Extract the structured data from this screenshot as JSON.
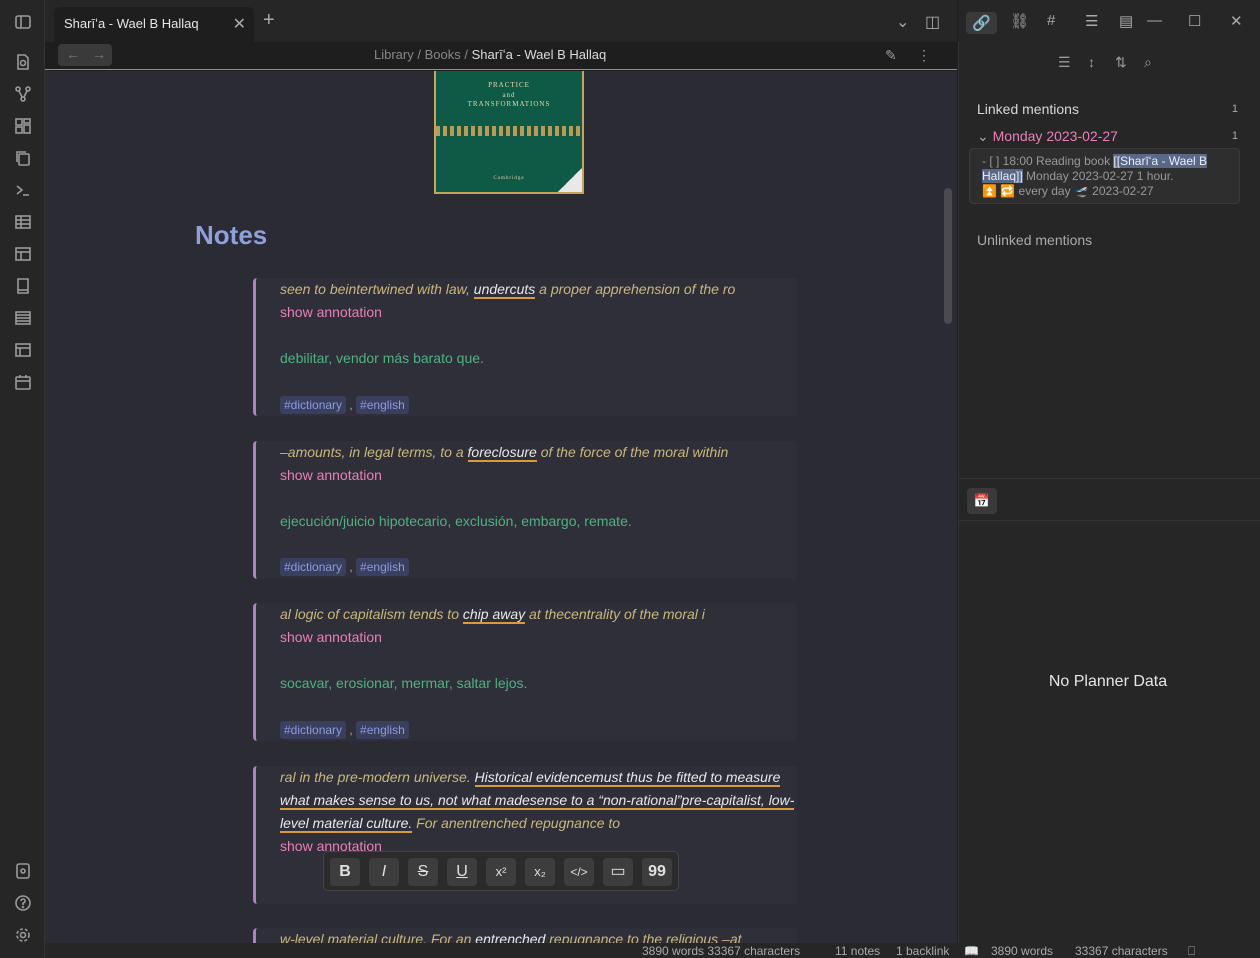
{
  "tab": {
    "title": "Sharīʻa - Wael B Hallaq"
  },
  "breadcrumb": {
    "library": "Library",
    "sep1": "/",
    "books": "Books",
    "sep2": "/",
    "current": "Sharīʻa - Wael B Hallaq"
  },
  "cover": {
    "line1": "PRACTICE",
    "line2": "and",
    "line3": "TRANSFORMATIONS",
    "publisher": "Cambridge"
  },
  "notes_heading": "Notes",
  "callouts": [
    {
      "pre": "seen to beintertwined with law, ",
      "hl": "undercuts",
      "post": " a proper apprehension of the ro",
      "show": "show annotation",
      "translation": "debilitar, vendor más barato que.",
      "tag1": "#dictionary",
      "tag2": "#english"
    },
    {
      "pre": "–amounts, in legal terms, to a ",
      "hl": "foreclosure",
      "post": " of the force of the moral within",
      "show": "show annotation",
      "translation": "ejecución/juicio hipotecario, exclusión, embargo, remate.",
      "tag1": "#dictionary",
      "tag2": "#english"
    },
    {
      "pre": "al logic of capitalism tends to ",
      "hl": "chip away",
      "post": " at thecentrality of the moral i",
      "show": "show annotation",
      "translation": "socavar, erosionar, mermar, saltar lejos.",
      "tag1": "#dictionary",
      "tag2": "#english"
    },
    {
      "pre": "ral in the pre-modern universe. ",
      "hl": "Historical evidencemust thus be fitted to measure what makes sense to us, not what madesense to a “non-rational”pre-capitalist, low-level material culture.",
      "post": " For anentrenched repugnance to",
      "show": "show annotation"
    },
    {
      "pre": "w-level material culture. For an ",
      "hl": "entrenched",
      "post": " repugnance to the religious –at"
    }
  ],
  "format_toolbar": [
    "B",
    "I",
    "S",
    "U",
    "x²",
    "x₂",
    "</>",
    "▭",
    "99"
  ],
  "status": {
    "words1": "3890 words 33367 characters",
    "notes": "11 notes",
    "backlink": "1 backlink",
    "words2": "3890 words",
    "chars2": "33367 characters"
  },
  "backlinks": {
    "linked_title": "Linked mentions",
    "linked_count": "1",
    "day": "Monday 2023-02-27",
    "day_count": "1",
    "entry_pre": "- [ ] 18:00 Reading book ",
    "entry_link": "[[Sharīʻa - Wael B Hallaq]]",
    "entry_post": " Monday 2023-02-27 1 hour.",
    "entry_line2": "⏫ 🔁 every day 🛫 2023-02-27",
    "unlinked_title": "Unlinked mentions"
  },
  "planner": {
    "empty": "No Planner Data"
  }
}
